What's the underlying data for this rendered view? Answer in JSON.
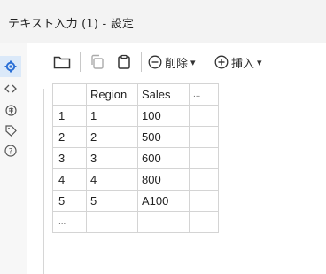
{
  "window": {
    "title": "テキスト入力 (1) - 設定"
  },
  "sidebar": {
    "items": [
      {
        "name": "settings-gear-icon",
        "glyph": "⚙",
        "active": true
      },
      {
        "name": "code-brackets-icon",
        "glyph": "<>",
        "active": false
      },
      {
        "name": "annotation-icon",
        "glyph": "⊛",
        "active": false
      },
      {
        "name": "tag-icon",
        "glyph": "◇",
        "active": false
      },
      {
        "name": "help-icon",
        "glyph": "?",
        "active": false
      }
    ]
  },
  "toolbar": {
    "delete_label": "削除",
    "insert_label": "挿入",
    "dropdown_glyph": "▾"
  },
  "grid": {
    "headers": [
      "",
      "Region",
      "Sales",
      "..."
    ],
    "rows": [
      [
        "1",
        "1",
        "100",
        ""
      ],
      [
        "2",
        "2",
        "500",
        ""
      ],
      [
        "3",
        "3",
        "600",
        ""
      ],
      [
        "4",
        "4",
        "800",
        ""
      ],
      [
        "5",
        "5",
        "A100",
        ""
      ],
      [
        "...",
        "",
        "",
        ""
      ]
    ]
  }
}
